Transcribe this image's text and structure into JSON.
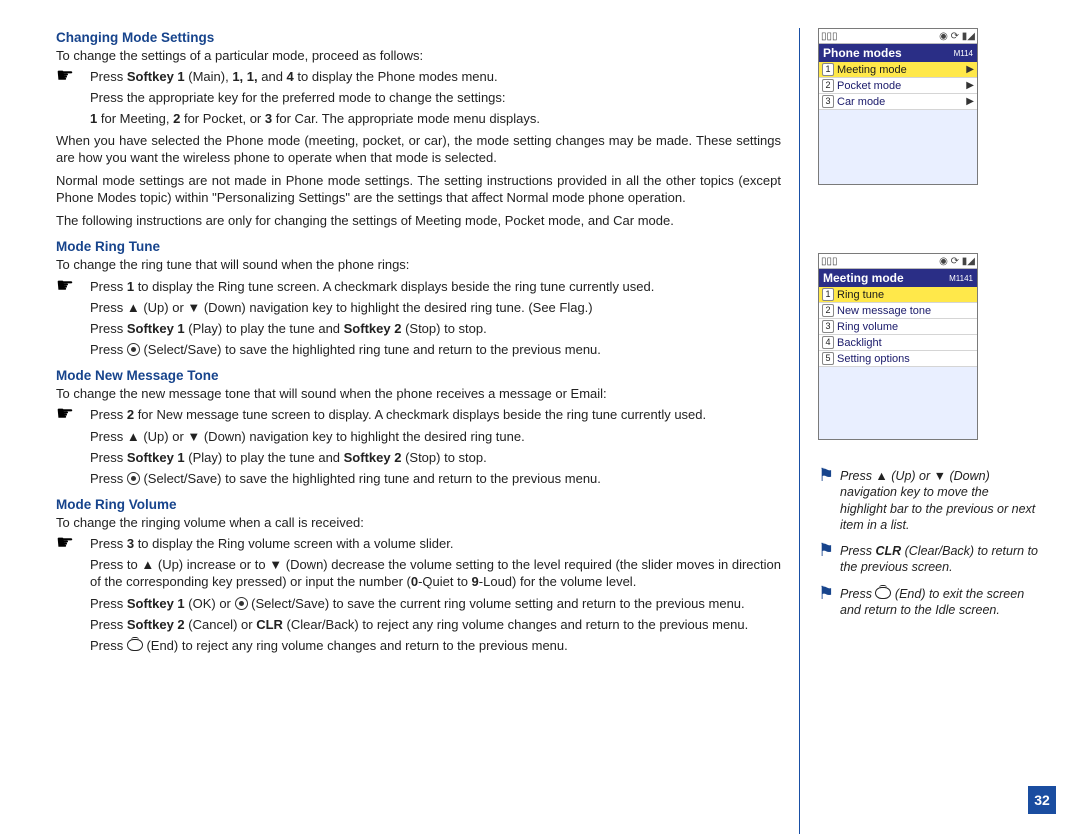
{
  "page_number": "32",
  "sections": {
    "changing": {
      "heading": "Changing Mode Settings",
      "intro": "To change the settings of a particular mode, proceed as follows:",
      "b1": "Press <b>Softkey 1</b> (Main), <b>1, 1,</b> and <b>4</b> to display the Phone modes menu.",
      "b1_sub1": "Press the appropriate key for the preferred mode to change the settings:",
      "b1_sub2": "<b>1</b> for Meeting, <b>2</b> for Pocket, or <b>3</b> for Car. The appropriate mode menu displays.",
      "p2": "When you have selected the Phone mode (meeting, pocket, or car), the mode setting changes may be made. These settings are how you want the wireless phone to operate when that mode is selected.",
      "p3": "Normal mode settings are not made in Phone mode settings. The setting instructions provided in all the other topics (except Phone Modes topic) within \"Personalizing Settings\" are the settings that affect Normal mode phone operation.",
      "p4": "The following instructions are only for changing the settings of Meeting mode, Pocket mode, and Car mode."
    },
    "ringtune": {
      "heading": "Mode Ring Tune",
      "intro": "To change the ring tune that will sound when the phone rings:",
      "b1": "Press <b>1</b> to display the Ring tune screen. A checkmark displays beside the ring tune currently used.",
      "s1": "Press ▲ (Up) or ▼ (Down) navigation key to highlight the desired ring tune. (See Flag.)",
      "s2": "Press <b>Softkey 1</b> (Play) to play the tune and <b>Softkey 2</b> (Stop) to stop.",
      "s3": "Press <span class=\"circ-dot\"></span> (Select/Save) to save the highlighted ring tune and return to the previous menu."
    },
    "msgtone": {
      "heading": "Mode New Message Tone",
      "intro": "To change the new message tone that will sound when the phone receives a message or Email:",
      "b1": "Press <b>2</b> for New message tune screen to display. A checkmark displays beside the ring tune currently used.",
      "s1": "Press ▲ (Up) or ▼ (Down) navigation key to highlight the desired ring tune.",
      "s2": "Press <b>Softkey 1</b> (Play) to play the tune and <b>Softkey 2</b> (Stop) to stop.",
      "s3": "Press <span class=\"circ-dot\"></span> (Select/Save) to save the highlighted ring tune and return to the previous menu."
    },
    "ringvol": {
      "heading": "Mode Ring Volume",
      "intro": "To change the ringing volume when a call is received:",
      "b1": "Press <b>3</b> to display the Ring volume screen with a volume slider.",
      "s1": "Press to ▲ (Up) increase or to ▼ (Down) decrease the volume setting to the level required (the slider moves in direction of the corresponding key pressed) or input the number (<b>0</b>-Quiet to <b>9</b>-Loud) for the volume level.",
      "s2": "Press <b>Softkey 1</b> (OK) or <span class=\"circ-dot\"></span> (Select/Save) to save the current ring volume setting and return to the previous menu.",
      "s3": "Press <b>Softkey 2</b> (Cancel) or <b>CLR</b> (Clear/Back) to reject any ring volume changes and return to the previous menu.",
      "s4": "Press <span class=\"end-key\"></span> (End) to reject any ring volume changes and return to the previous menu."
    }
  },
  "sidebar": {
    "phone1": {
      "status_left": "▯▯▯",
      "status_right": "◉ ⟳ ▮◢",
      "title": "Phone modes",
      "code": "M114",
      "items": [
        {
          "n": "1",
          "t": "Meeting mode",
          "sel": true,
          "arrow": true
        },
        {
          "n": "2",
          "t": "Pocket mode",
          "sel": false,
          "arrow": true
        },
        {
          "n": "3",
          "t": "Car mode",
          "sel": false,
          "arrow": true
        }
      ]
    },
    "phone2": {
      "status_left": "▯▯▯",
      "status_right": "◉ ⟳ ▮◢",
      "title": "Meeting mode",
      "code": "M1141",
      "items": [
        {
          "n": "1",
          "t": "Ring tune",
          "sel": true,
          "arrow": false
        },
        {
          "n": "2",
          "t": "New message tone",
          "sel": false,
          "arrow": false
        },
        {
          "n": "3",
          "t": "Ring volume",
          "sel": false,
          "arrow": false
        },
        {
          "n": "4",
          "t": "Backlight",
          "sel": false,
          "arrow": false
        },
        {
          "n": "5",
          "t": "Setting options",
          "sel": false,
          "arrow": false
        }
      ]
    },
    "tips": {
      "t1": "Press ▲ (Up) or ▼ (Down) navigation key to move the highlight bar to the previous or next item in a list.",
      "t2": "Press <b>CLR</b> (Clear/Back) to return to the previous screen.",
      "t3": "Press <span class=\"end-key\"></span> (End) to exit the screen and return to the Idle screen."
    }
  }
}
